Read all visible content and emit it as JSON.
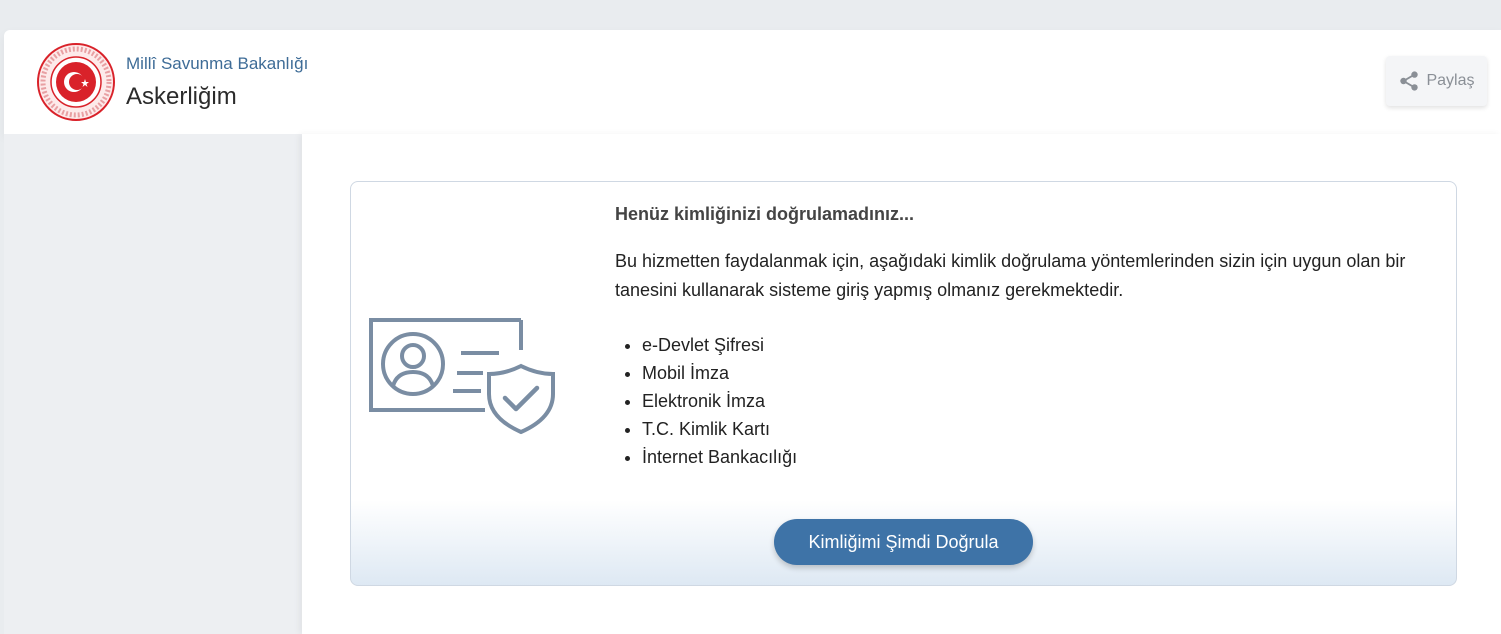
{
  "header": {
    "org_name": "Millî Savunma Bakanlığı",
    "app_name": "Askerliğim",
    "share_label": "Paylaş",
    "logo_icon": "ministry-seal-icon",
    "share_icon": "share-icon"
  },
  "card": {
    "title": "Henüz kimliğinizi doğrulamadınız...",
    "description": "Bu hizmetten faydalanmak için, aşağıdaki kimlik doğrulama yöntemlerinden sizin için uygun olan bir tanesini kullanarak sisteme giriş yapmış olmanız gerekmektedir.",
    "methods": [
      "e-Devlet Şifresi",
      "Mobil İmza",
      "Elektronik İmza",
      "T.C. Kimlik Kartı",
      "İnternet Bankacılığı"
    ],
    "button_label": "Kimliğimi Şimdi Doğrula",
    "illustration_icon": "id-card-shield-icon"
  },
  "colors": {
    "accent": "#3e73a7",
    "org_text": "#3e6c97",
    "seal_red": "#d9222a",
    "icon_gray": "#7a8da3"
  }
}
